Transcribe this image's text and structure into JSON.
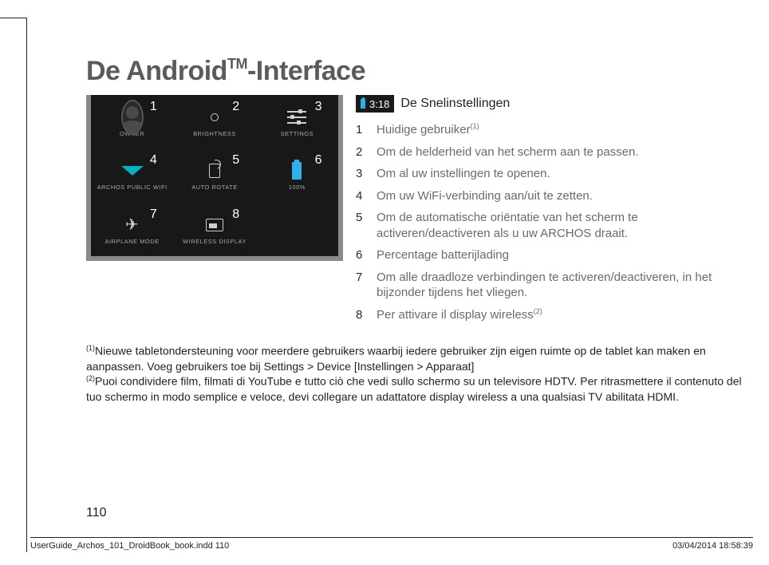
{
  "title_prefix": "De Android",
  "title_tm": "TM",
  "title_suffix": "-Interface",
  "status_time": "3:18",
  "snelinstellingen_label": "De Snelinstellingen",
  "tile_numbers": {
    "t1": "1",
    "t2": "2",
    "t3": "3",
    "t4": "4",
    "t5": "5",
    "t6": "6",
    "t7": "7",
    "t8": "8"
  },
  "tile_labels": {
    "owner": "OWNER",
    "brightness": "BRIGHTNESS",
    "settings": "SETTINGS",
    "wifi": "ARCHOS PUBLIC WIFI",
    "rotate": "AUTO ROTATE",
    "battery": "100%",
    "airplane": "AIRPLANE MODE",
    "cast": "WIRELESS DISPLAY"
  },
  "legend": [
    {
      "n": "1",
      "text": "Huidige gebruiker",
      "sup": "(1)"
    },
    {
      "n": "2",
      "text": "Om de helderheid van het scherm aan te passen."
    },
    {
      "n": "3",
      "text": "Om al uw instellingen te openen."
    },
    {
      "n": "4",
      "text": "Om uw WiFi-verbinding aan/uit te zetten."
    },
    {
      "n": "5",
      "text": "Om de automatische oriëntatie van het scherm te activeren/deactiveren als u uw ARCHOS draait."
    },
    {
      "n": "6",
      "text": "Percentage batterijlading"
    },
    {
      "n": "7",
      "text": "Om alle draadloze verbindingen te activeren/deactiveren, in het bijzonder tijdens het vliegen."
    },
    {
      "n": "8",
      "text": "Per attivare il display wireless",
      "sup": "(2)"
    }
  ],
  "footnote1_sup": "(1)",
  "footnote1_text": "Nieuwe tabletondersteuning voor meerdere gebruikers waarbij iedere gebruiker zijn eigen ruimte op de tablet kan maken en aanpassen. Voeg gebruikers toe bij Settings > Device [Instellingen > Apparaat]",
  "footnote2_sup": "(2)",
  "footnote2_text": "Puoi condividere film, filmati di YouTube e tutto ciò che vedi sullo schermo su un televisore HDTV. Per ritrasmettere il contenuto del tuo schermo in modo semplice e veloce, devi collegare un adattatore display wireless a una qualsiasi TV abilitata HDMI.",
  "page_number": "110",
  "footer_left": "UserGuide_Archos_101_DroidBook_book.indd   110",
  "footer_right": "03/04/2014   18:58:39"
}
